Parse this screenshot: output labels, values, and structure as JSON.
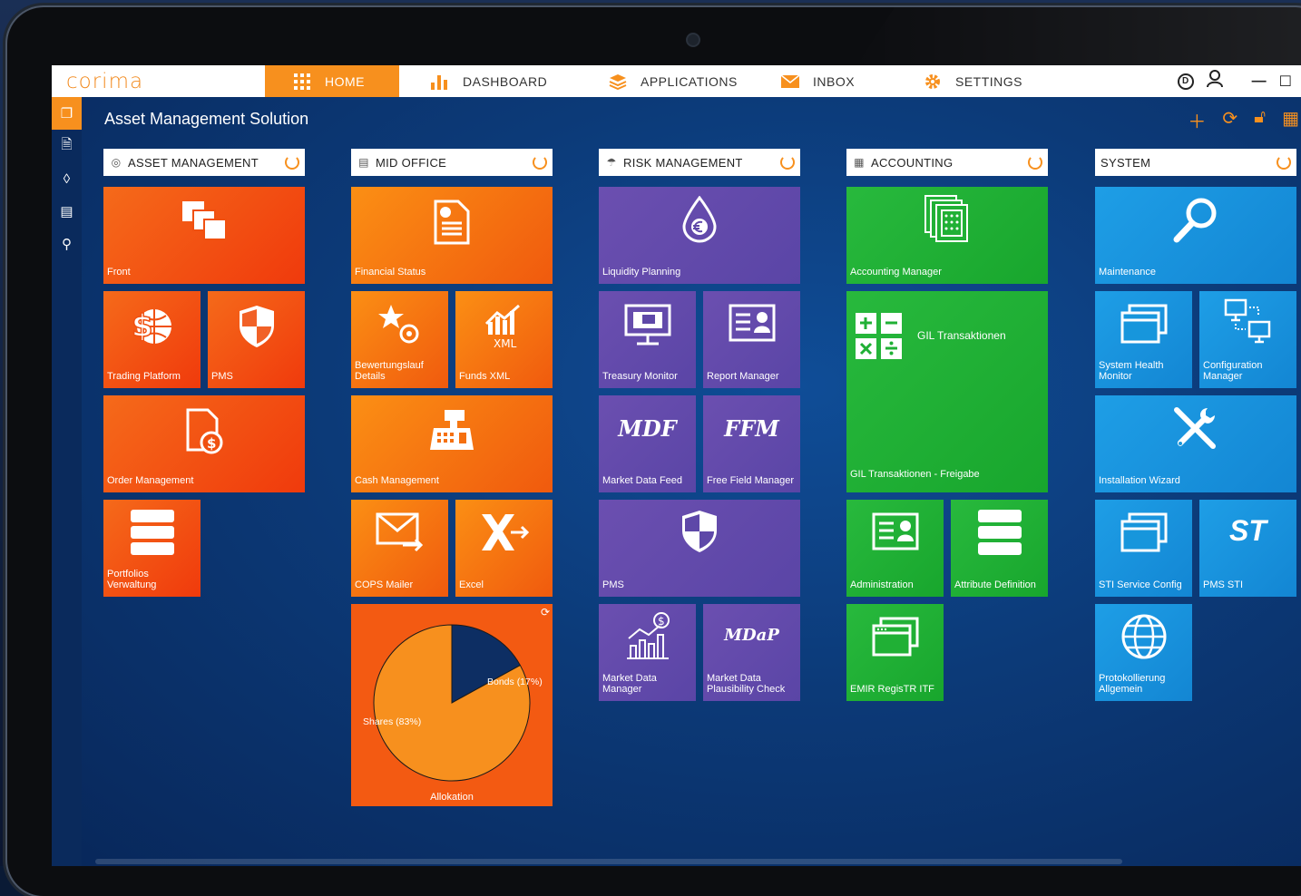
{
  "app": {
    "logo": "corima",
    "page_title": "Asset Management Solution"
  },
  "nav": [
    {
      "label": "HOME",
      "icon": "grid-icon"
    },
    {
      "label": "DASHBOARD",
      "icon": "bar-chart-icon"
    },
    {
      "label": "APPLICATIONS",
      "icon": "layers-icon"
    },
    {
      "label": "INBOX",
      "icon": "mail-icon"
    },
    {
      "label": "SETTINGS",
      "icon": "gear-icon"
    }
  ],
  "columns": [
    {
      "title": "ASSET MANAGEMENT",
      "icon": "target-icon"
    },
    {
      "title": "MID OFFICE",
      "icon": "document-icon"
    },
    {
      "title": "RISK MANAGEMENT",
      "icon": "umbrella-icon"
    },
    {
      "title": "ACCOUNTING",
      "icon": "calculator-icon"
    },
    {
      "title": "SYSTEM",
      "icon": ""
    }
  ],
  "tiles": {
    "front": "Front",
    "trading_platform": "Trading Platform",
    "pms": "PMS",
    "order_management": "Order Management",
    "portfolios": "Portfolios Verwaltung",
    "financial_status": "Financial Status",
    "bewertungslauf": "Bewertungslauf Details",
    "funds_xml": "Funds XML",
    "cash_management": "Cash Management",
    "cops_mailer": "COPS Mailer",
    "excel": "Excel",
    "liquidity_planning": "Liquidity Planning",
    "treasury_monitor": "Treasury Monitor",
    "report_manager": "Report Manager",
    "market_data_feed": "Market Data Feed",
    "free_field_manager": "Free Field Manager",
    "risk_pms": "PMS",
    "market_data_manager": "Market Data Manager",
    "market_data_plausibility": "Market Data Plausibility Check",
    "accounting_manager": "Accounting Manager",
    "gil_transaktionen": "GIL Transaktionen",
    "gil_freigabe": "GIL Transaktionen - Freigabe",
    "administration": "Administration",
    "attribute_definition": "Attribute Definition",
    "emir": "EMIR RegisTR ITF",
    "maintenance": "Maintenance",
    "system_health": "System Health Monitor",
    "configuration_manager": "Configuration Manager",
    "installation_wizard": "Installation Wizard",
    "sti_service_config": "STI Service Config",
    "pms_sti": "PMS STI",
    "protokollierung": "Protokollierung Allgemein"
  },
  "icon_text": {
    "xml": "XML",
    "mdf": "MDF",
    "ffm": "FFM",
    "mdap": "MDaP",
    "st": "ST",
    "dollar": "$"
  },
  "chart_data": {
    "type": "pie",
    "title": "Allokation",
    "slices": [
      {
        "label": "Shares (83%)",
        "value": 83,
        "color": "#f7901e"
      },
      {
        "label": "Bonds (17%)",
        "value": 17,
        "color": "#0d2e63"
      }
    ]
  },
  "colors": {
    "accent": "#f7901e",
    "orange": "#f04a10",
    "purple": "#5e48a8",
    "green": "#1fae34",
    "blue": "#1796dc"
  }
}
